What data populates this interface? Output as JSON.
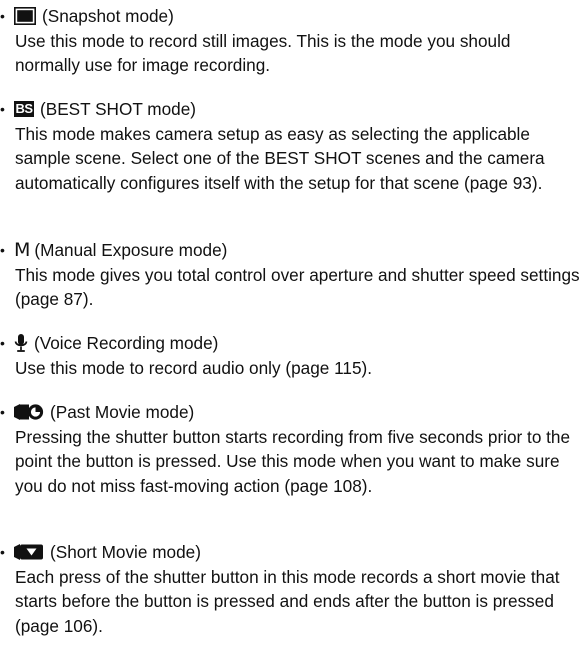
{
  "items": [
    {
      "bullet": "•",
      "icon": "snapshot-mode-icon",
      "title": "(Snapshot mode)",
      "desc": "Use this mode to record still images. This is the mode you should normally use for image recording."
    },
    {
      "bullet": "•",
      "icon": "best-shot-icon",
      "icon_text": "BS",
      "title": "(BEST SHOT mode)",
      "desc": "This mode makes camera setup as easy as selecting the applicable sample scene. Select one of the BEST SHOT scenes and the camera automatically configures itself with the setup for that scene (page 93)."
    },
    {
      "bullet": "•",
      "icon": "manual-exposure-icon",
      "icon_text": "M",
      "title": "(Manual Exposure mode)",
      "desc": "This mode gives you total control over aperture and shutter speed settings (page 87)."
    },
    {
      "bullet": "•",
      "icon": "microphone-icon",
      "title": "(Voice Recording mode)",
      "desc": "Use this mode to record audio only (page 115)."
    },
    {
      "bullet": "•",
      "icon": "past-movie-icon",
      "title": "(Past Movie mode)",
      "desc": "Pressing the shutter button starts recording from five seconds prior to the point the button is pressed. Use this mode when you want to make sure you do not miss fast-moving action (page 108)."
    },
    {
      "bullet": "•",
      "icon": "short-movie-icon",
      "title": "(Short Movie mode)",
      "desc": "Each press of the shutter button in this mode records a short movie that starts before the button is pressed and ends after the button is pressed (page 106)."
    }
  ]
}
